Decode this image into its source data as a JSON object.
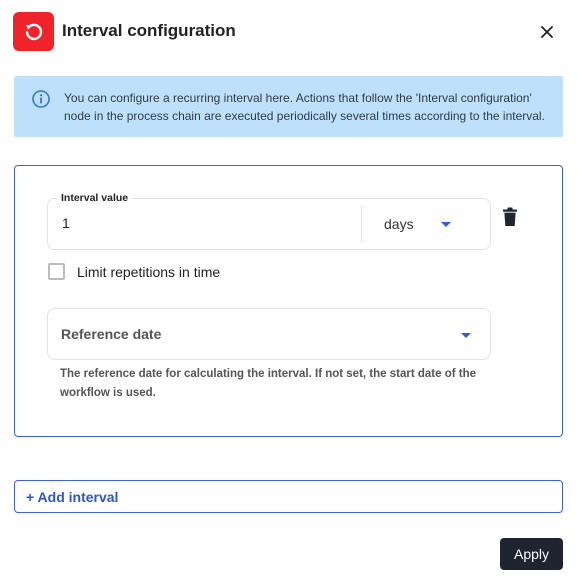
{
  "dialog": {
    "title": "Interval configuration",
    "header_icon": "reset-icon",
    "close_icon": "close-icon"
  },
  "info": {
    "icon": "info-icon",
    "text": "You can configure a recurring interval here. Actions that follow the 'Interval configuration' node in the process chain are executed periodically several times according to the interval."
  },
  "interval": {
    "label": "Interval value",
    "value": "1",
    "unit": "days",
    "delete_icon": "trash-icon"
  },
  "limit": {
    "label": "Limit repetitions in time",
    "checked": false
  },
  "reference": {
    "placeholder": "Reference date",
    "hint": "The reference date for calculating the interval. If not set, the start date of the workflow is used."
  },
  "actions": {
    "add_interval": "+ Add interval",
    "apply": "Apply"
  },
  "colors": {
    "accent": "#2f55cf",
    "header_icon_bg": "#f0232a",
    "info_bg": "#bfe0fa",
    "apply_bg": "#1e2530"
  }
}
